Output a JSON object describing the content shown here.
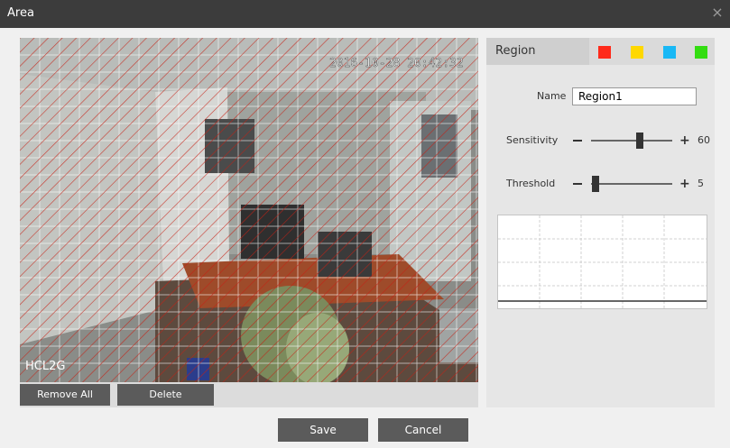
{
  "window": {
    "title": "Area",
    "close_glyph": "×"
  },
  "video": {
    "timestamp": "2016-10-28 20:42:32",
    "camera_label": "HCL2G"
  },
  "left_buttons": {
    "remove_all": "Remove All",
    "delete": "Delete"
  },
  "region": {
    "tab_label": "Region",
    "colors": [
      {
        "name": "red",
        "hex": "#ff2a1a"
      },
      {
        "name": "yellow",
        "hex": "#ffd800"
      },
      {
        "name": "blue",
        "hex": "#19b8f5"
      },
      {
        "name": "green",
        "hex": "#33dd11"
      }
    ],
    "name_label": "Name",
    "name_value": "Region1",
    "sensitivity": {
      "label": "Sensitivity",
      "value": "60",
      "level": 0.6
    },
    "threshold": {
      "label": "Threshold",
      "value": "5",
      "level": 0.05
    }
  },
  "footer": {
    "save": "Save",
    "cancel": "Cancel"
  }
}
